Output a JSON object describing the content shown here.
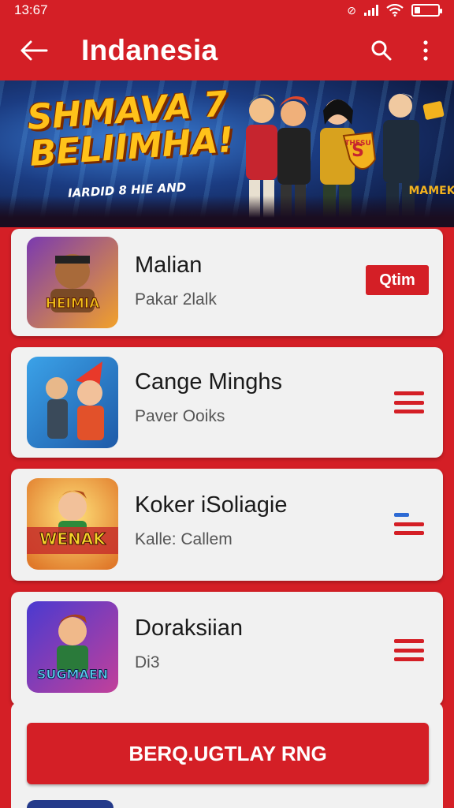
{
  "status_bar": {
    "time": "13:67"
  },
  "app_bar": {
    "title": "Indanesia",
    "back_icon": "arrow-left-icon",
    "search_icon": "search-icon",
    "more_icon": "more-vertical-icon"
  },
  "banner": {
    "headline_line1": "SHMAVA 7",
    "headline_line2": "BELIIMHA!",
    "subline": "IARDID 8 HIE AND",
    "badge_text": "THESU",
    "corner_text": "MAMEK"
  },
  "games": [
    {
      "name": "Malian",
      "subtitle": "Pakar 2lalk",
      "thumb_text": "HEIMIA",
      "thumb_colors": [
        "#6a2fa0",
        "#f2a12a"
      ],
      "action": "button",
      "action_label": "Qtim"
    },
    {
      "name": "Cange Minghs",
      "subtitle": "Paver Ooiks",
      "thumb_text": "",
      "thumb_colors": [
        "#2d8ad6",
        "#e2512a"
      ],
      "action": "menu",
      "action_icon": "menu-icon"
    },
    {
      "name": "Koker iSoliagie",
      "subtitle": "Kalle: Callem",
      "thumb_text": "WENAK",
      "thumb_colors": [
        "#f5c12a",
        "#c7302a"
      ],
      "action": "menu",
      "action_icon": "menu-icon"
    },
    {
      "name": "Doraksiian",
      "subtitle": "Di3",
      "thumb_text": "SUGMAEN",
      "thumb_colors": [
        "#3b55c8",
        "#c2409a"
      ],
      "action": "menu",
      "action_icon": "menu-icon"
    }
  ],
  "cta": {
    "label": "BERQ.UGTLAY RNG"
  },
  "colors": {
    "primary": "#d41f26",
    "card": "#f1f1f1"
  }
}
